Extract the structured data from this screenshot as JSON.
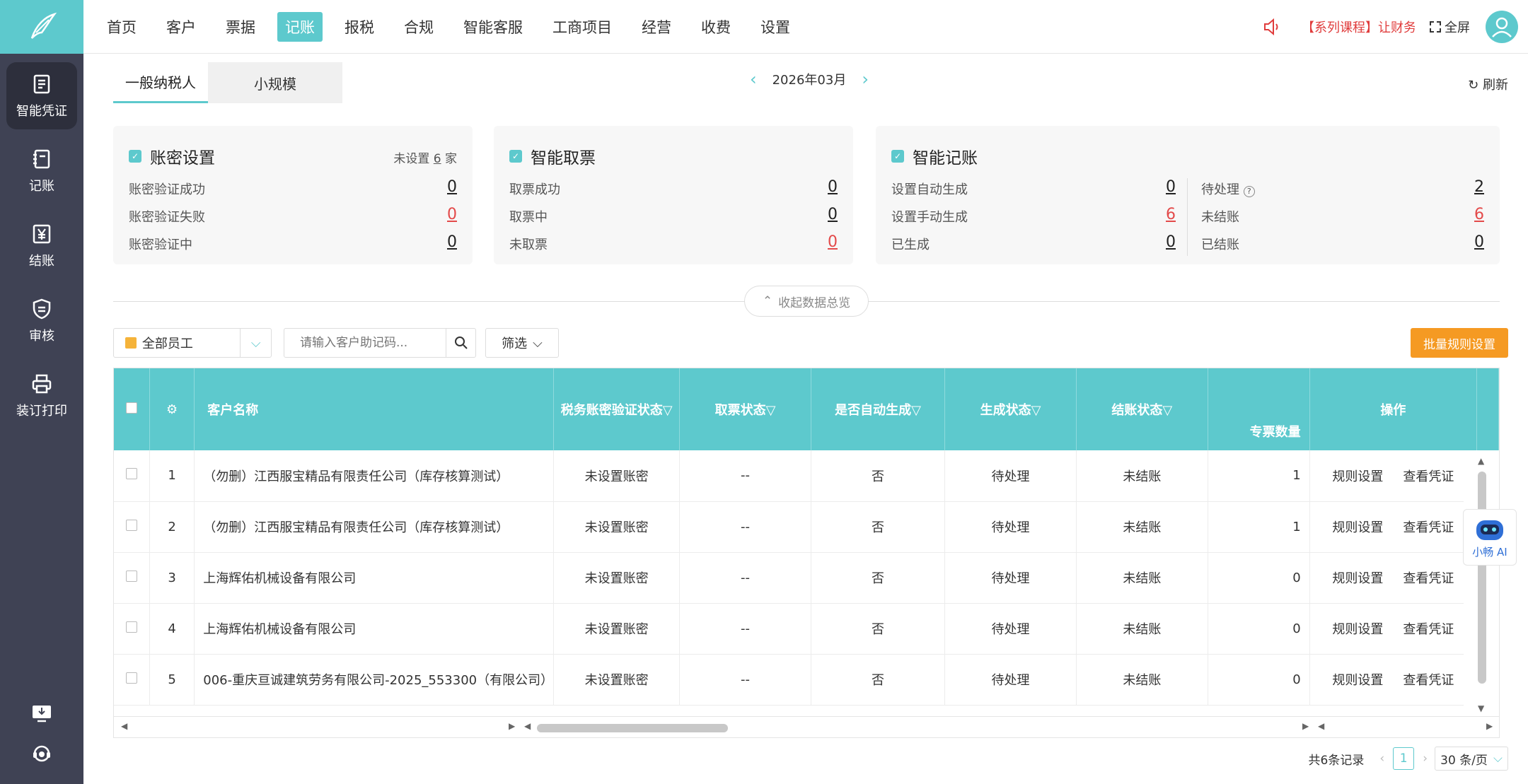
{
  "nav": {
    "items": [
      "首页",
      "客户",
      "票据",
      "记账",
      "报税",
      "合规",
      "智能客服",
      "工商项目",
      "经营",
      "收费",
      "设置"
    ],
    "active_index": 3,
    "marquee": "【系列课程】让财务非",
    "fullscreen": "全屏"
  },
  "sidebar": {
    "items": [
      {
        "label": "智能凭证",
        "icon": "voucher-icon"
      },
      {
        "label": "记账",
        "icon": "notebook-icon"
      },
      {
        "label": "结账",
        "icon": "yen-icon"
      },
      {
        "label": "审核",
        "icon": "shield-icon"
      },
      {
        "label": "装订打印",
        "icon": "printer-icon"
      }
    ]
  },
  "tabs": {
    "general": "一般纳税人",
    "small": "小规模"
  },
  "month": "2026年03月",
  "refresh": "刷新",
  "cards": {
    "account": {
      "title": "账密设置",
      "extra_prefix": "未设置",
      "extra_count": "6",
      "extra_suffix": "家",
      "rows": [
        {
          "label": "账密验证成功",
          "value": "0"
        },
        {
          "label": "账密验证失败",
          "value": "0"
        },
        {
          "label": "账密验证中",
          "value": "0"
        }
      ]
    },
    "ticket": {
      "title": "智能取票",
      "rows": [
        {
          "label": "取票成功",
          "value": "0"
        },
        {
          "label": "取票中",
          "value": "0"
        },
        {
          "label": "未取票",
          "value": "0"
        }
      ]
    },
    "booking": {
      "title": "智能记账",
      "left_rows": [
        {
          "label": "设置自动生成",
          "value": "0"
        },
        {
          "label": "设置手动生成",
          "value": "6"
        },
        {
          "label": "已生成",
          "value": "0"
        }
      ],
      "right_rows": [
        {
          "label": "待处理",
          "value": "2"
        },
        {
          "label": "未结账",
          "value": "6"
        },
        {
          "label": "已结账",
          "value": "0"
        }
      ]
    }
  },
  "collapse_label": "收起数据总览",
  "toolbar": {
    "staff_select": "全部员工",
    "search_placeholder": "请输入客户助记码...",
    "filter": "筛选",
    "batch": "批量规则设置"
  },
  "table": {
    "headers": {
      "name": "客户名称",
      "verify": "税务账密验证状态",
      "ticket": "取票状态",
      "auto": "是否自动生成",
      "gen": "生成状态",
      "settle": "结账状态",
      "special": "专票数量",
      "ops": "操作"
    },
    "rows": [
      {
        "no": "1",
        "name": "（勿删）江西服宝精品有限责任公司（库存核算测试）",
        "verify": "未设置账密",
        "ticket": "--",
        "auto": "否",
        "gen": "待处理",
        "settle": "未结账",
        "special": "1",
        "op1": "规则设置",
        "op2": "查看凭证"
      },
      {
        "no": "2",
        "name": "（勿删）江西服宝精品有限责任公司（库存核算测试）",
        "verify": "未设置账密",
        "ticket": "--",
        "auto": "否",
        "gen": "待处理",
        "settle": "未结账",
        "special": "1",
        "op1": "规则设置",
        "op2": "查看凭证"
      },
      {
        "no": "3",
        "name": "上海辉佑机械设备有限公司",
        "verify": "未设置账密",
        "ticket": "--",
        "auto": "否",
        "gen": "待处理",
        "settle": "未结账",
        "special": "0",
        "op1": "规则设置",
        "op2": "查看凭证"
      },
      {
        "no": "4",
        "name": "上海辉佑机械设备有限公司",
        "verify": "未设置账密",
        "ticket": "--",
        "auto": "否",
        "gen": "待处理",
        "settle": "未结账",
        "special": "0",
        "op1": "规则设置",
        "op2": "查看凭证"
      },
      {
        "no": "5",
        "name": "006-重庆亘诚建筑劳务有限公司-2025_553300（有限公司）",
        "verify": "未设置账密",
        "ticket": "--",
        "auto": "否",
        "gen": "待处理",
        "settle": "未结账",
        "special": "0",
        "op1": "规则设置",
        "op2": "查看凭证"
      }
    ]
  },
  "pager": {
    "total": "共6条记录",
    "page": "1",
    "size": "30 条/页"
  },
  "ai_label": "小畅 AI",
  "colors": {
    "accent": "#5dc9cd",
    "warn": "#f59a23",
    "red": "#e34a4a",
    "sidebar": "#3f4254"
  }
}
